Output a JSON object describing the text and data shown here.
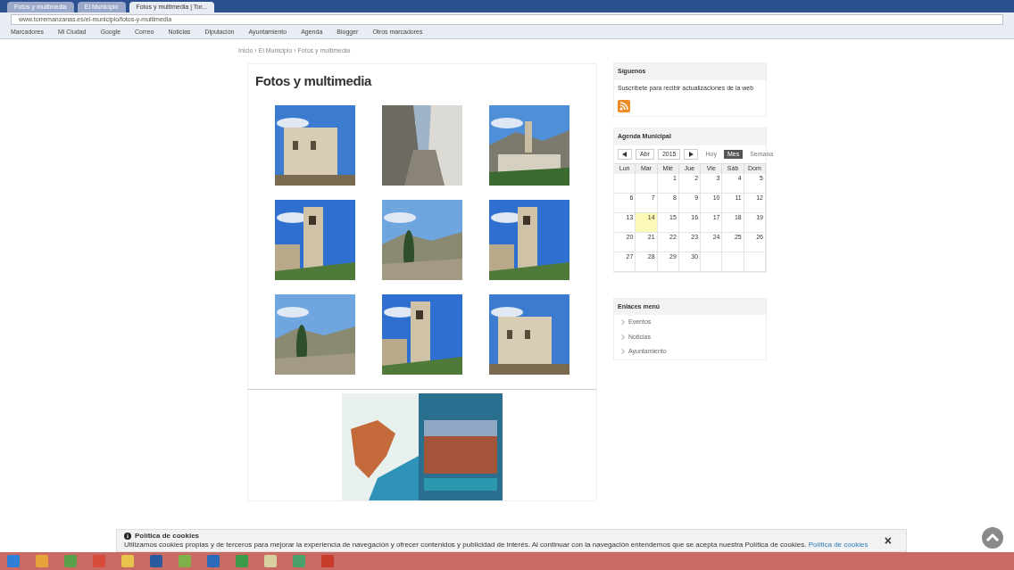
{
  "browser": {
    "tabs": [
      {
        "label": "Fotos y multimedia",
        "selected": false
      },
      {
        "label": "El Municipio",
        "selected": false
      },
      {
        "label": "Fotos y multimedia | Tor...",
        "selected": true
      }
    ],
    "url": "www.torremanzanas.es/el-municipio/fotos-y-multimedia",
    "bookmarks": [
      "Marcadores",
      "Mi Ciudad",
      "Google",
      "Correo",
      "Noticias",
      "Diputación",
      "Ayuntamiento",
      "Agenda",
      "Blogger",
      "Otros marcadores"
    ]
  },
  "breadcrumb": "Inicio › El Municipio › Fotos y multimedia",
  "page_title": "Fotos y multimedia",
  "sidebar": {
    "subscribe": {
      "title": "Síguenos",
      "text": "Suscríbete para recibir actualizaciones de la web"
    },
    "calendar": {
      "title": "Agenda Municipal",
      "month": "Abr",
      "year": "2015",
      "buttons": [
        {
          "label": "Hoy",
          "selected": false
        },
        {
          "label": "Mes",
          "selected": true
        },
        {
          "label": "Semana",
          "selected": false
        }
      ],
      "weekdays": [
        "Lun",
        "Mar",
        "Mié",
        "Jue",
        "Vie",
        "Sáb",
        "Dom"
      ],
      "weeks": [
        [
          {
            "label": "1",
            "selected": false
          },
          {
            "label": "2",
            "selected": false
          },
          {
            "label": "3",
            "selected": false
          },
          {
            "label": "4",
            "selected": false
          },
          {
            "label": "5",
            "selected": false
          }
        ],
        [
          {
            "label": "6",
            "selected": false
          },
          {
            "label": "7",
            "selected": false
          },
          {
            "label": "8",
            "selected": false
          },
          {
            "label": "9",
            "selected": false
          },
          {
            "label": "10",
            "selected": false
          },
          {
            "label": "11",
            "selected": false
          },
          {
            "label": "12",
            "selected": false
          }
        ],
        [
          {
            "label": "13",
            "selected": false
          },
          {
            "label": "14",
            "selected": true
          },
          {
            "label": "15",
            "selected": false
          },
          {
            "label": "16",
            "selected": false
          },
          {
            "label": "17",
            "selected": false
          },
          {
            "label": "18",
            "selected": false
          },
          {
            "label": "19",
            "selected": false
          }
        ],
        [
          {
            "label": "20",
            "selected": false
          },
          {
            "label": "21",
            "selected": false
          },
          {
            "label": "22",
            "selected": false
          },
          {
            "label": "23",
            "selected": false
          },
          {
            "label": "24",
            "selected": false
          },
          {
            "label": "25",
            "selected": false
          },
          {
            "label": "26",
            "selected": false
          }
        ],
        [
          {
            "label": "27",
            "selected": false
          },
          {
            "label": "28",
            "selected": false
          },
          {
            "label": "29",
            "selected": false
          },
          {
            "label": "30",
            "selected": false
          }
        ]
      ]
    },
    "links": {
      "title": "Enlaces menú",
      "items": [
        "Eventos",
        "Noticias",
        "Ayuntamiento"
      ]
    }
  },
  "cookie": {
    "title": "Política de cookies",
    "text": "Utilizamos cookies propias y de terceros para mejorar la experiencia de navegación y ofrecer contenidos y publicidad de interés. Al continuar con la navegación entendemos que se acepta nuestra Política de cookies.",
    "link": "Política de cookies",
    "close": "×"
  }
}
